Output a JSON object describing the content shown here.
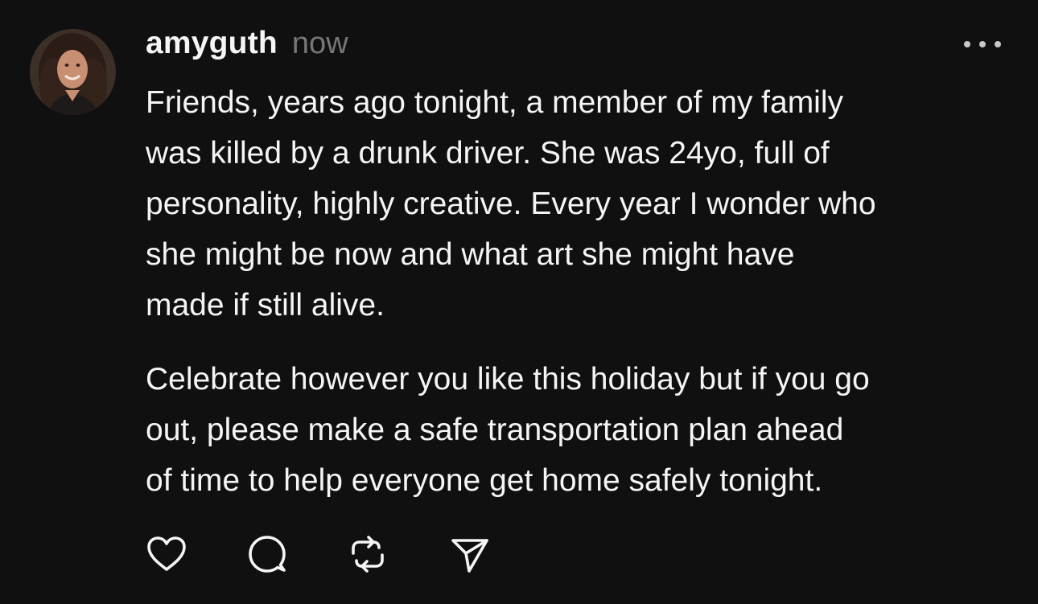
{
  "post": {
    "author": {
      "username": "amyguth",
      "avatar_icon": "profile-photo"
    },
    "timestamp": "now",
    "more_icon": "more-horizontal-icon",
    "paragraphs": [
      "Friends, years ago tonight, a member of my family\nwas killed by a drunk driver. She was 24yo, full of\npersonality, highly creative. Every year I wonder who\nshe might be now and what art she might have\nmade if still alive.",
      "Celebrate however you like this holiday but if you go\nout, please make a safe transportation plan ahead\nof time to help everyone get home safely tonight."
    ],
    "actions": [
      {
        "name": "like",
        "icon": "heart-icon"
      },
      {
        "name": "reply",
        "icon": "comment-icon"
      },
      {
        "name": "repost",
        "icon": "repost-icon"
      },
      {
        "name": "share",
        "icon": "send-icon"
      }
    ]
  },
  "colors": {
    "background": "#101010",
    "text": "#f3f5f7",
    "muted": "#777777"
  }
}
